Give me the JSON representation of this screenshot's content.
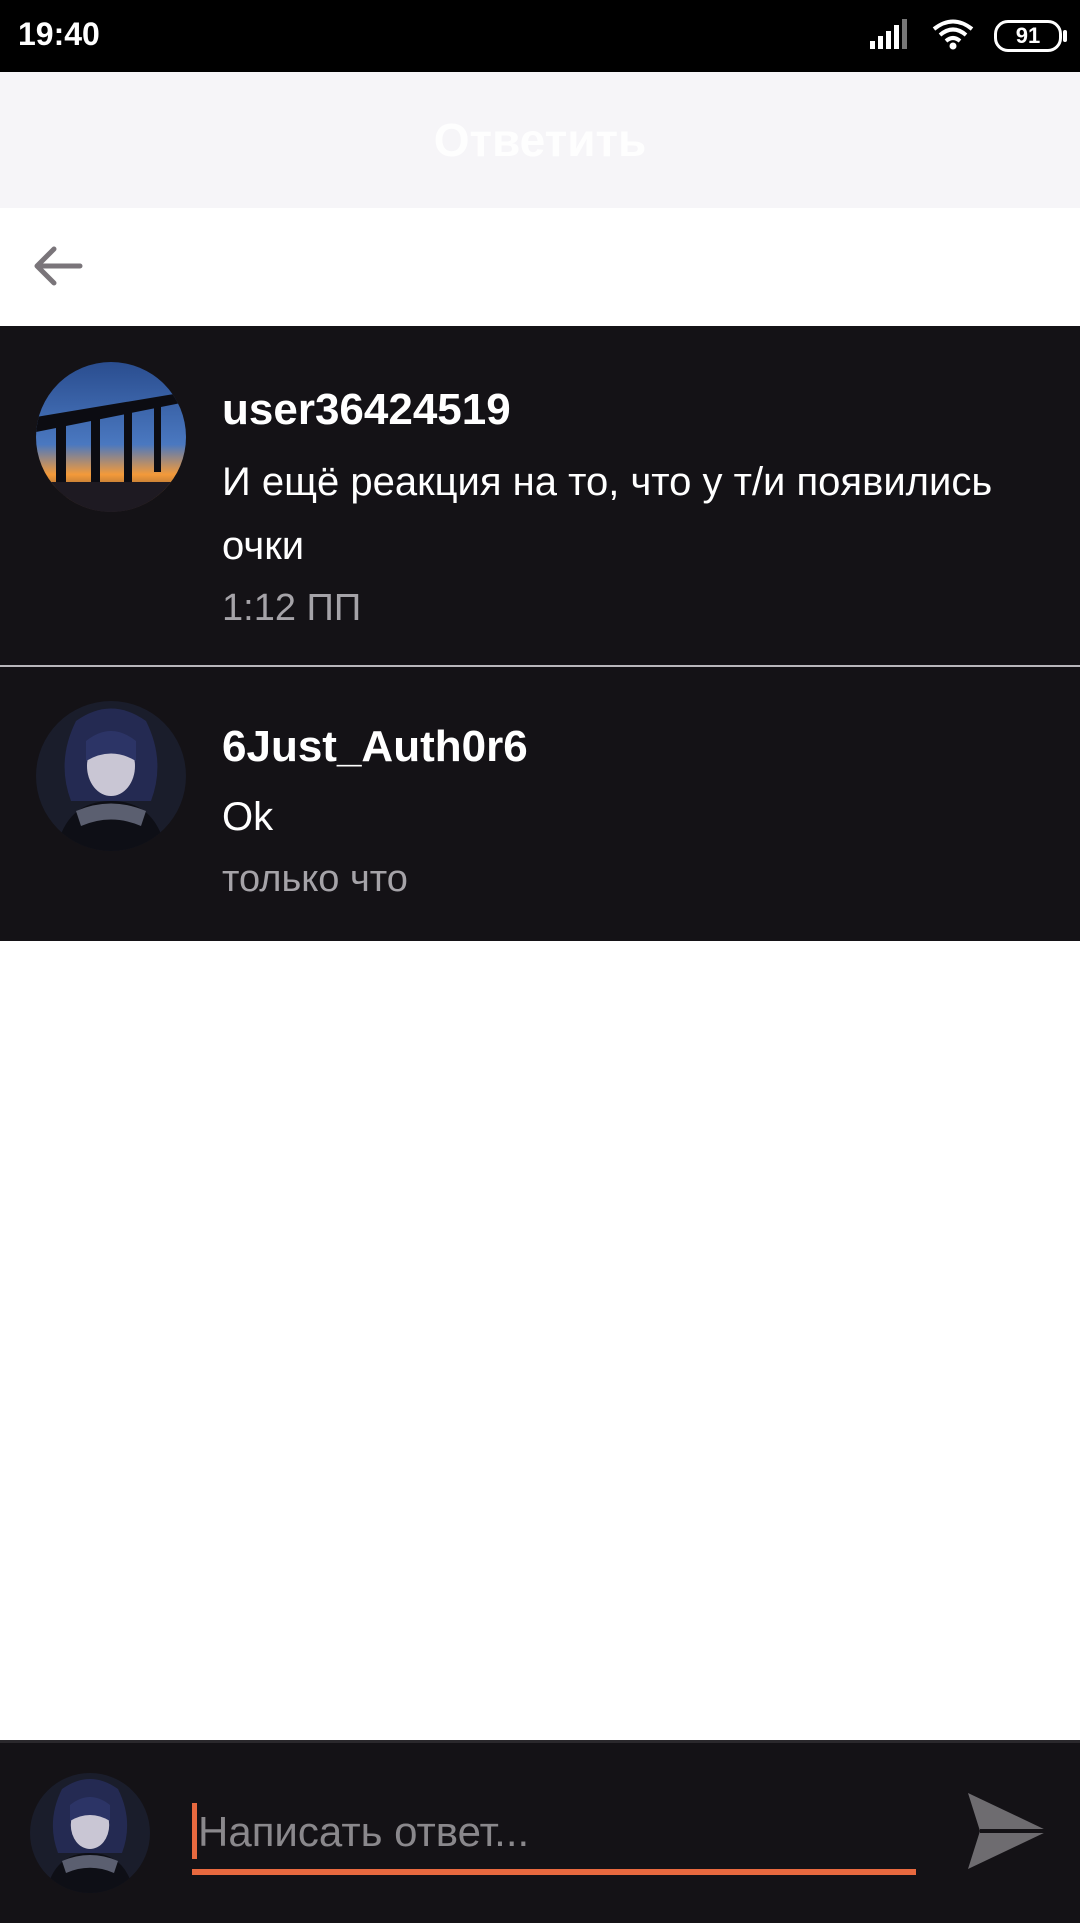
{
  "status_bar": {
    "time": "19:40",
    "battery": "91",
    "icons": [
      "signal-icon",
      "wifi-icon",
      "battery-icon"
    ]
  },
  "header": {
    "title": "Ответить"
  },
  "nav": {
    "back_icon": "arrow-left-icon"
  },
  "comments": [
    {
      "username": "user36424519",
      "text": "И ещё реакция на то, что у т/и появились очки",
      "time": "1:12 ПП",
      "avatar": "bridge-sunset-avatar"
    },
    {
      "username": "6Just_Auth0r6",
      "text": "Ok",
      "time": "только что",
      "avatar": "anime-character-avatar"
    }
  ],
  "reply": {
    "placeholder": "Написать ответ...",
    "value": "",
    "send_icon": "send-icon"
  },
  "colors": {
    "accent": "#e8693f",
    "comment_bg": "#141216",
    "title_bg": "#f6f5f8"
  }
}
